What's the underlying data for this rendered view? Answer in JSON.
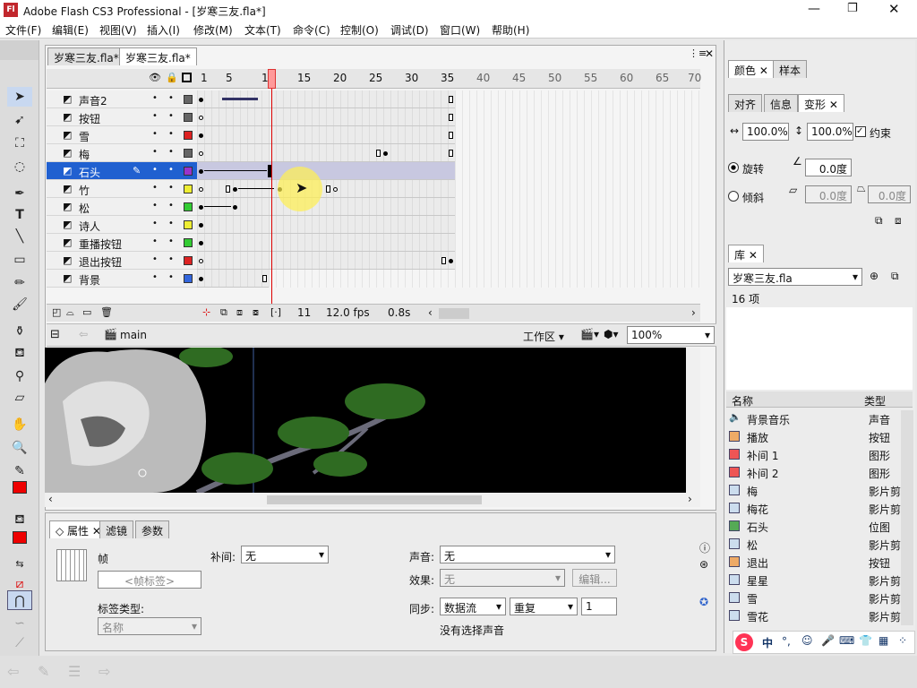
{
  "window": {
    "title": "Adobe Flash CS3 Professional - [岁寒三友.fla*]",
    "app_icon": "Fl"
  },
  "menu": [
    "文件(F)",
    "编辑(E)",
    "视图(V)",
    "插入(I)",
    "修改(M)",
    "文本(T)",
    "命令(C)",
    "控制(O)",
    "调试(D)",
    "窗口(W)",
    "帮助(H)"
  ],
  "doc_tabs": [
    "岁寒三友.fla*",
    "岁寒三友.fla*"
  ],
  "timeline": {
    "frame_numbers": [
      "1",
      "5",
      "10",
      "15",
      "20",
      "25",
      "30",
      "35",
      "40",
      "45",
      "50",
      "55",
      "60",
      "65",
      "70"
    ],
    "playhead_frame": "10",
    "layers": [
      {
        "name": "声音2",
        "color": "#666666"
      },
      {
        "name": "按钮",
        "color": "#666666"
      },
      {
        "name": "雪",
        "color": "#dd2222"
      },
      {
        "name": "梅",
        "color": "#666666"
      },
      {
        "name": "石头",
        "color": "#9933cc",
        "selected": true
      },
      {
        "name": "竹",
        "color": "#eeee33"
      },
      {
        "name": "松",
        "color": "#33cc33"
      },
      {
        "name": "诗人",
        "color": "#eeee33"
      },
      {
        "name": "重播按钮",
        "color": "#33cc33"
      },
      {
        "name": "退出按钮",
        "color": "#dd2222"
      },
      {
        "name": "背景",
        "color": "#3366dd"
      }
    ],
    "status_frame": "11",
    "status_fps": "12.0 fps",
    "status_time": "0.8s"
  },
  "edit_bar": {
    "scene": "main",
    "workspace": "工作区",
    "zoom": "100%"
  },
  "props": {
    "tabs": [
      "属性",
      "滤镜",
      "参数"
    ],
    "frame_label": "帧",
    "frame_name_placeholder": "<帧标签>",
    "label_type_label": "标签类型:",
    "label_type_value": "名称",
    "tween_label": "补间:",
    "tween_value": "无",
    "sound_label": "声音:",
    "sound_value": "无",
    "effect_label": "效果:",
    "effect_value": "无",
    "edit_button": "编辑...",
    "sync_label": "同步:",
    "sync_value": "数据流",
    "repeat_value": "重复",
    "repeat_count": "1",
    "no_sound": "没有选择声音"
  },
  "right": {
    "color_tabs": [
      "颜色",
      "样本"
    ],
    "transform_tabs": [
      "对齐",
      "信息",
      "变形"
    ],
    "scale_w": "100.0%",
    "scale_h": "100.0%",
    "constrain": "约束",
    "rotate_label": "旋转",
    "rotate_value": "0.0度",
    "skew_label": "倾斜",
    "skew_h": "0.0度",
    "skew_v": "0.0度",
    "library_tab": "库",
    "library_file": "岁寒三友.fla",
    "item_count": "16 项",
    "col_name": "名称",
    "col_type": "类型",
    "items": [
      {
        "name": "背景音乐",
        "type": "声音"
      },
      {
        "name": "播放",
        "type": "按钮"
      },
      {
        "name": "补间 1",
        "type": "图形"
      },
      {
        "name": "补间 2",
        "type": "图形"
      },
      {
        "name": "梅",
        "type": "影片剪"
      },
      {
        "name": "梅花",
        "type": "影片剪"
      },
      {
        "name": "石头",
        "type": "位图"
      },
      {
        "name": "松",
        "type": "影片剪"
      },
      {
        "name": "退出",
        "type": "按钮"
      },
      {
        "name": "星星",
        "type": "影片剪"
      },
      {
        "name": "雪",
        "type": "影片剪"
      },
      {
        "name": "雪花",
        "type": "影片剪"
      }
    ]
  },
  "ime": {
    "label": "中"
  }
}
